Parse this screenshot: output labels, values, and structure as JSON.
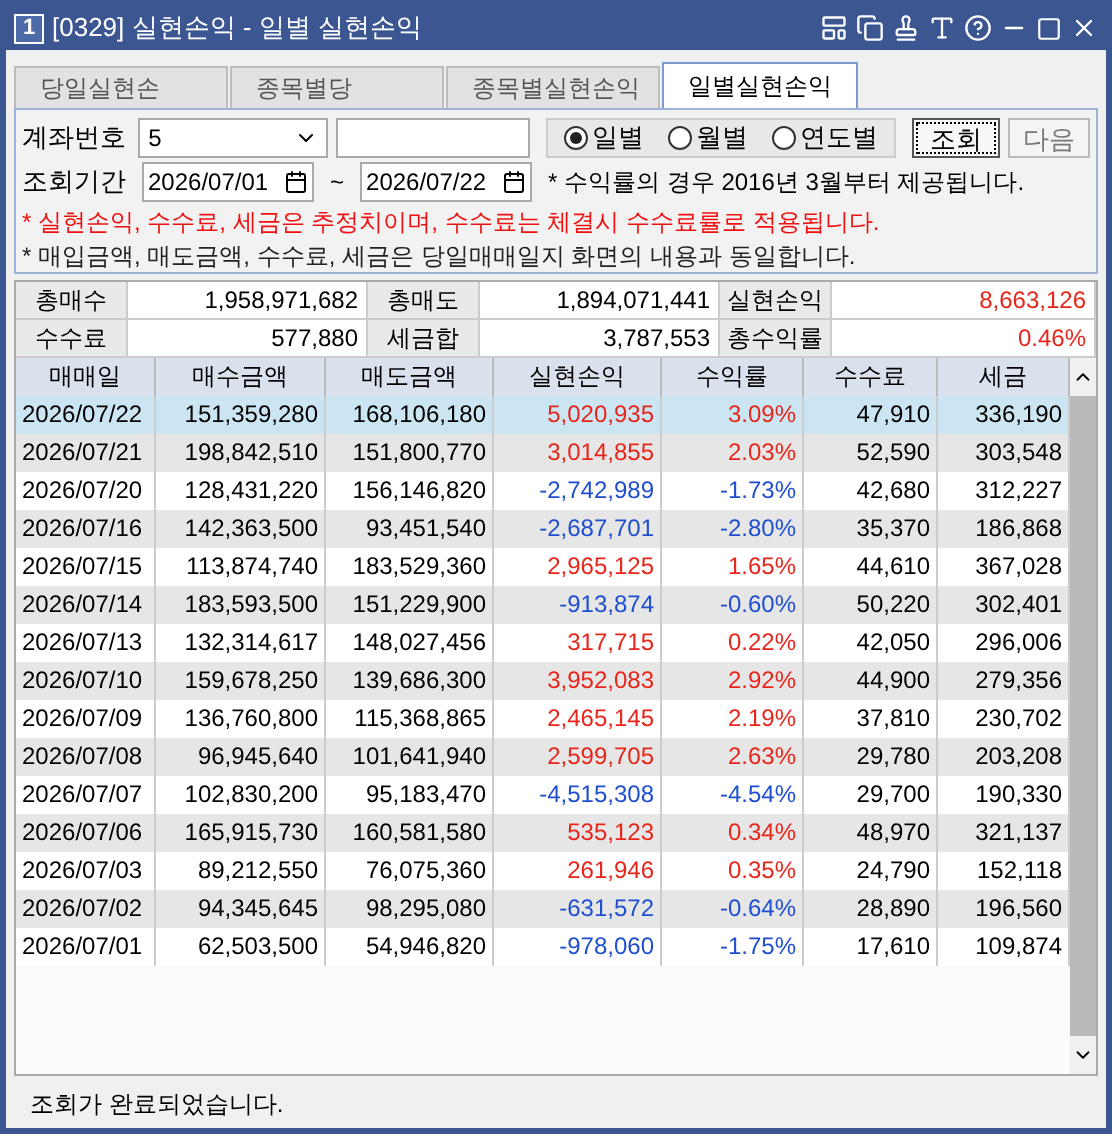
{
  "window": {
    "badge": "1",
    "title": "[0329] 실현손익 - 일별 실현손익"
  },
  "tabs": [
    {
      "label": "당일실현손",
      "selected": false
    },
    {
      "label": "종목별당",
      "selected": false
    },
    {
      "label": "종목별실현손익",
      "selected": false
    },
    {
      "label": "일별실현손익",
      "selected": true
    }
  ],
  "form": {
    "account_label": "계좌번호",
    "account_value": "5",
    "period_label": "조회기간",
    "start_date": "2026/07/01",
    "separator": "~",
    "end_date": "2026/07/22",
    "note": "* 수익률의 경우 2016년 3월부터 제공됩니다.",
    "radios": [
      {
        "label": "일별",
        "selected": true
      },
      {
        "label": "월별",
        "selected": false
      },
      {
        "label": "연도별",
        "selected": false
      }
    ],
    "buttons": [
      {
        "label": "조회",
        "disabled": false
      },
      {
        "label": "다음",
        "disabled": true
      }
    ]
  },
  "notices": [
    {
      "text": "* 실현손익, 수수료, 세금은 추정치이며, 수수료는 체결시 수수료률로 적용됩니다.",
      "kind": "warning"
    },
    {
      "text": "* 매입금액, 매도금액, 수수료, 세금은 당일매매일지 화면의 내용과 동일합니다.",
      "kind": "info"
    }
  ],
  "summary": [
    [
      {
        "label": "총매수",
        "value": "1,958,971,682",
        "color": "#000000"
      },
      {
        "label": "총매도",
        "value": "1,894,071,441",
        "color": "#000000"
      },
      {
        "label": "실현손익",
        "value": "8,663,126",
        "color": "#e8251b"
      }
    ],
    [
      {
        "label": "수수료",
        "value": "577,880",
        "color": "#000000"
      },
      {
        "label": "세금합",
        "value": "3,787,553",
        "color": "#000000"
      },
      {
        "label": "총수익률",
        "value": "0.46%",
        "color": "#e8251b"
      }
    ]
  ],
  "table": {
    "columns": [
      "매매일",
      "매수금액",
      "매도금액",
      "실현손익",
      "수익률",
      "수수료",
      "세금"
    ],
    "rows": [
      {
        "selected": true,
        "color": "#e8251b",
        "cells": [
          "2026/07/22",
          "151,359,280",
          "168,106,180",
          "5,020,935",
          "3.09%",
          "47,910",
          "336,190"
        ]
      },
      {
        "selected": false,
        "color": "#e8251b",
        "cells": [
          "2026/07/21",
          "198,842,510",
          "151,800,770",
          "3,014,855",
          "2.03%",
          "52,590",
          "303,548"
        ]
      },
      {
        "selected": false,
        "color": "#1f4fd0",
        "cells": [
          "2026/07/20",
          "128,431,220",
          "156,146,820",
          "-2,742,989",
          "-1.73%",
          "42,680",
          "312,227"
        ]
      },
      {
        "selected": false,
        "color": "#1f4fd0",
        "cells": [
          "2026/07/16",
          "142,363,500",
          "93,451,540",
          "-2,687,701",
          "-2.80%",
          "35,370",
          "186,868"
        ]
      },
      {
        "selected": false,
        "color": "#e8251b",
        "cells": [
          "2026/07/15",
          "113,874,740",
          "183,529,360",
          "2,965,125",
          "1.65%",
          "44,610",
          "367,028"
        ]
      },
      {
        "selected": false,
        "color": "#1f4fd0",
        "cells": [
          "2026/07/14",
          "183,593,500",
          "151,229,900",
          "-913,874",
          "-0.60%",
          "50,220",
          "302,401"
        ]
      },
      {
        "selected": false,
        "color": "#e8251b",
        "cells": [
          "2026/07/13",
          "132,314,617",
          "148,027,456",
          "317,715",
          "0.22%",
          "42,050",
          "296,006"
        ]
      },
      {
        "selected": false,
        "color": "#e8251b",
        "cells": [
          "2026/07/10",
          "159,678,250",
          "139,686,300",
          "3,952,083",
          "2.92%",
          "44,900",
          "279,356"
        ]
      },
      {
        "selected": false,
        "color": "#e8251b",
        "cells": [
          "2026/07/09",
          "136,760,800",
          "115,368,865",
          "2,465,145",
          "2.19%",
          "37,810",
          "230,702"
        ]
      },
      {
        "selected": false,
        "color": "#e8251b",
        "cells": [
          "2026/07/08",
          "96,945,640",
          "101,641,940",
          "2,599,705",
          "2.63%",
          "29,780",
          "203,208"
        ]
      },
      {
        "selected": false,
        "color": "#1f4fd0",
        "cells": [
          "2026/07/07",
          "102,830,200",
          "95,183,470",
          "-4,515,308",
          "-4.54%",
          "29,700",
          "190,330"
        ]
      },
      {
        "selected": false,
        "color": "#e8251b",
        "cells": [
          "2026/07/06",
          "165,915,730",
          "160,581,580",
          "535,123",
          "0.34%",
          "48,970",
          "321,137"
        ]
      },
      {
        "selected": false,
        "color": "#e8251b",
        "cells": [
          "2026/07/03",
          "89,212,550",
          "76,075,360",
          "261,946",
          "0.35%",
          "24,790",
          "152,118"
        ]
      },
      {
        "selected": false,
        "color": "#1f4fd0",
        "cells": [
          "2026/07/02",
          "94,345,645",
          "98,295,080",
          "-631,572",
          "-0.64%",
          "28,890",
          "196,560"
        ]
      },
      {
        "selected": false,
        "color": "#1f4fd0",
        "cells": [
          "2026/07/01",
          "62,503,500",
          "54,946,820",
          "-978,060",
          "-1.75%",
          "17,610",
          "109,874"
        ]
      }
    ]
  },
  "status_bar": "조회가 완료되었습니다."
}
